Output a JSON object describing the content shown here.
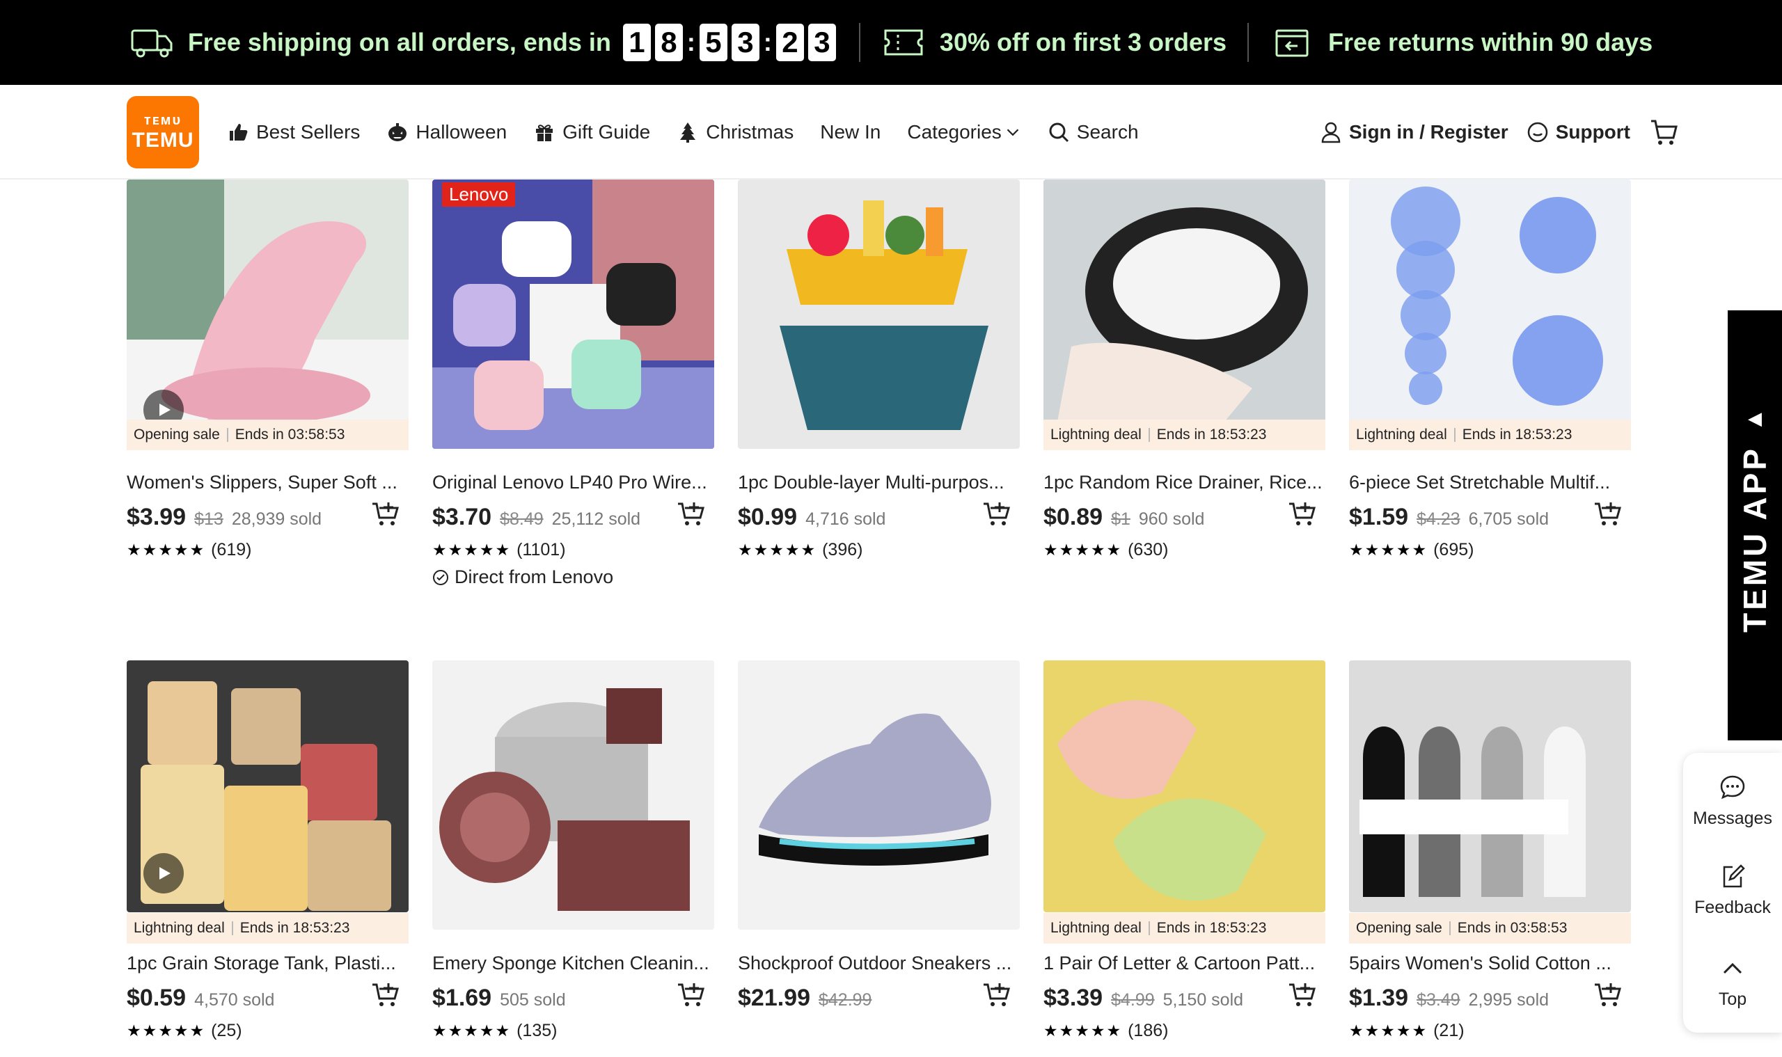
{
  "promo": {
    "shipping_text": "Free shipping on all orders, ends in",
    "timer_digits": [
      "1",
      "8",
      "5",
      "3",
      "2",
      "3"
    ],
    "discount_text": "30% off on first 3 orders",
    "returns_text": "Free returns within 90 days",
    "text_color": "#c8f7c5"
  },
  "header": {
    "logo_top": "ᴛᴇᴍᴜ",
    "logo_bottom": "TEMU",
    "nav": {
      "best_sellers": "Best Sellers",
      "halloween": "Halloween",
      "gift_guide": "Gift Guide",
      "christmas": "Christmas",
      "new_in": "New In",
      "categories": "Categories",
      "search": "Search"
    },
    "sign_in": "Sign in / Register",
    "support": "Support",
    "brand_color": "#fb7701"
  },
  "products": [
    {
      "title": "Women's Slippers, Super Soft ...",
      "price": "$3.99",
      "orig": "$13",
      "sold": "28,939 sold",
      "reviews": "(619)",
      "deal_type": "Opening sale",
      "deal_ends": "Ends in 03:58:53",
      "video": true
    },
    {
      "title": "Original Lenovo LP40 Pro Wire...",
      "price": "$3.70",
      "orig": "$8.49",
      "sold": "25,112 sold",
      "reviews": "(1101)",
      "direct": "Direct from Lenovo",
      "brand_tag": "Lenovo"
    },
    {
      "title": "1pc Double-layer Multi-purpos...",
      "price": "$0.99",
      "sold": "4,716 sold",
      "reviews": "(396)"
    },
    {
      "title": "1pc Random Rice Drainer, Rice...",
      "price": "$0.89",
      "orig": "$1",
      "sold": "960 sold",
      "reviews": "(630)",
      "deal_type": "Lightning deal",
      "deal_ends": "Ends in 18:53:23"
    },
    {
      "title": "6-piece Set Stretchable Multif...",
      "price": "$1.59",
      "orig": "$4.23",
      "sold": "6,705 sold",
      "reviews": "(695)",
      "deal_type": "Lightning deal",
      "deal_ends": "Ends in 18:53:23"
    },
    {
      "title": "1pc Grain Storage Tank, Plasti...",
      "price": "$0.59",
      "sold": "4,570 sold",
      "reviews": "(25)",
      "deal_type": "Lightning deal",
      "deal_ends": "Ends in 18:53:23",
      "video": true
    },
    {
      "title": "Emery Sponge Kitchen Cleanin...",
      "price": "$1.69",
      "sold": "505 sold",
      "reviews": "(135)"
    },
    {
      "title": "Shockproof Outdoor Sneakers ...",
      "price": "$21.99",
      "orig": "$42.99"
    },
    {
      "title": "1 Pair Of Letter & Cartoon Patt...",
      "price": "$3.39",
      "orig": "$4.99",
      "sold": "5,150 sold",
      "reviews": "(186)",
      "deal_type": "Lightning deal",
      "deal_ends": "Ends in 18:53:23"
    },
    {
      "title": "5pairs Women's Solid Cotton ...",
      "price": "$1.39",
      "orig": "$3.49",
      "sold": "2,995 sold",
      "reviews": "(21)",
      "deal_type": "Opening sale",
      "deal_ends": "Ends in 03:58:53"
    }
  ],
  "side": {
    "app_banner": "TEMU APP",
    "messages": "Messages",
    "feedback": "Feedback",
    "top": "Top"
  }
}
